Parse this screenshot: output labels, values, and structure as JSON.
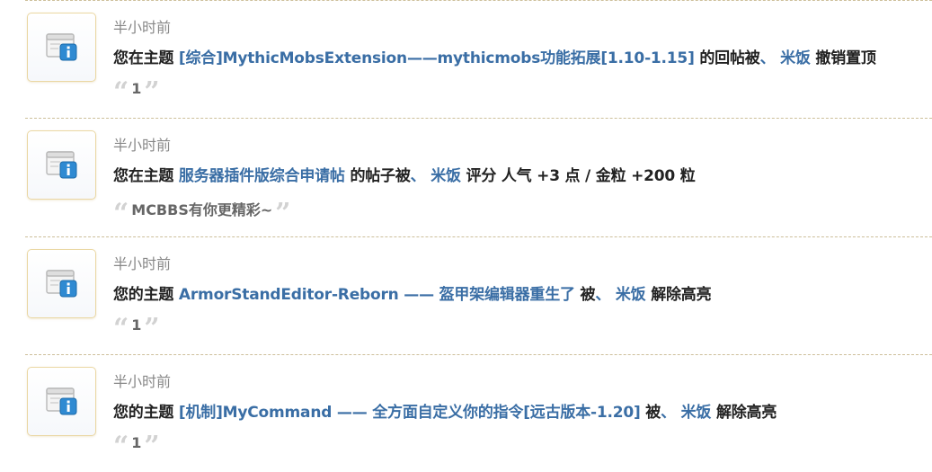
{
  "colors": {
    "link": "#3a6ea5",
    "text": "#222222",
    "time": "#888888",
    "divider": "#cdbf9a"
  },
  "notices": [
    {
      "icon": "info-icon",
      "time": "半小时前",
      "prefix": "您在主题",
      "topic": "[综合]MythicMobsExtension——mythicmobs功能拓展[1.10-1.15]",
      "middle": "的回帖被",
      "sep": "、",
      "user": "米饭",
      "action": "撤销置顶",
      "quote_open": "“",
      "quote": "1",
      "quote_close": "”"
    },
    {
      "icon": "info-icon",
      "time": "半小时前",
      "prefix": "您在主题",
      "topic": "服务器插件版综合申请帖",
      "middle": "的帖子被",
      "sep": "、",
      "user": "米饭",
      "action": "评分 人气 +3 点 / 金粒 +200 粒",
      "quote_open": "“",
      "quote": "MCBBS有你更精彩~",
      "quote_close": "”"
    },
    {
      "icon": "info-icon",
      "time": "半小时前",
      "prefix": "您的主题",
      "topic": "ArmorStandEditor-Reborn —— 盔甲架编辑器重生了",
      "middle": "被",
      "sep": "、",
      "user": "米饭",
      "action": "解除高亮",
      "quote_open": "“",
      "quote": "1",
      "quote_close": "”"
    },
    {
      "icon": "info-icon",
      "time": "半小时前",
      "prefix": "您的主题",
      "topic": "[机制]MyCommand —— 全方面自定义你的指令[远古版本-1.20]",
      "middle": "被",
      "sep": "、",
      "user": "米饭",
      "action": "解除高亮",
      "quote_open": "“",
      "quote": "1",
      "quote_close": "”"
    }
  ]
}
